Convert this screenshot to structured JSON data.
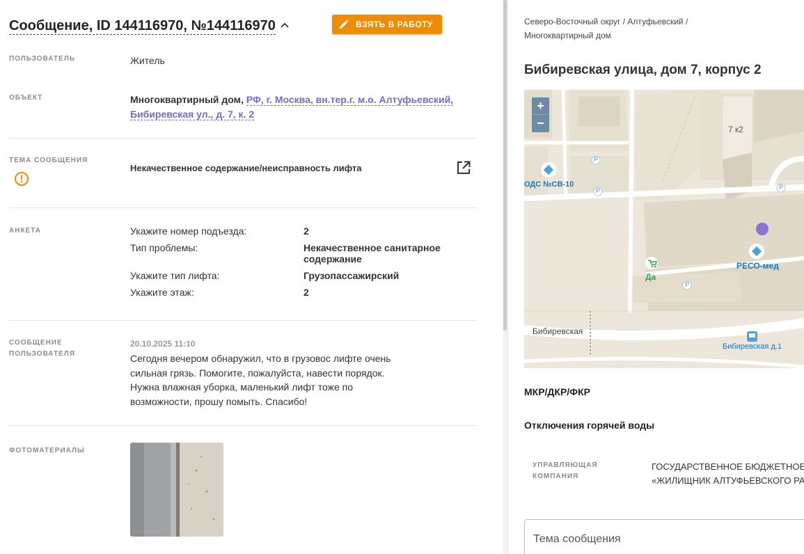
{
  "message": {
    "title": "Сообщение, ID 144116970, №144116970",
    "take_button_label": "ВЗЯТЬ В РАБОТУ",
    "user_label": "ПОЛЬЗОВАТЕЛЬ",
    "user_value": "Житель",
    "object_label": "ОБЪЕКТ",
    "object_type": "Многоквартирный дом,",
    "object_addr_line1": "РФ, г. Москва, вн.тер.г. м.о. Алтуфьевский,",
    "object_addr_line2": "Бибиревская ул., д. 7, к. 2",
    "topic_label": "ТЕМА СООБЩЕНИЯ",
    "topic_value": "Некачественное содержание/неисправность лифта",
    "form_label": "АНКЕТА",
    "form_items": [
      {
        "q": "Укажите номер подъезда:",
        "a": "2"
      },
      {
        "q": "Тип проблемы:",
        "a": "Некачественное санитарное содержание"
      },
      {
        "q": "Укажите тип лифта:",
        "a": "Грузопассажирский"
      },
      {
        "q": "Укажите этаж:",
        "a": "2"
      }
    ],
    "user_msg_label_1": "СООБЩЕНИЕ",
    "user_msg_label_2": "ПОЛЬЗОВАТЕЛЯ",
    "user_msg_date": "20.10.2025 11:10",
    "user_msg_lines": [
      "Сегодня вечером обнаружил, что в грузовос лифте очень",
      "сильная грязь. Помогите, пожалуйста, навести порядок.",
      "Нужна влажная уборка, маленький лифт тоже по",
      "возможности, прошу помыть. Спасибо!"
    ],
    "photos_label": "ФОТОМАТЕРИАЛЫ"
  },
  "side": {
    "breadcrumb_line1": "Северо-Восточный округ / Алтуфьевский /",
    "breadcrumb_line2": "Многоквартирный дом",
    "address": "Бибиревская улица, дом 7, корпус 2",
    "map": {
      "zoom_in": "+",
      "zoom_out": "−",
      "building_label": "7 к2",
      "ods_label": "ОДС №СВ-10",
      "reso_label": "РЕСО-мед",
      "da_label": "Да",
      "street_label": "Бибиревская",
      "bus_stop_label": "Бибиревская д.1",
      "parking": "P",
      "marker_color": "#8c72d6"
    },
    "mkr_label": "МКР/ДКР/ФКР",
    "hot_water_label": "Отключения горячей воды",
    "mc_label_1": "УПРАВЛЯЮЩАЯ",
    "mc_label_2": "КОМПАНИЯ",
    "mc_value_1": "ГОСУДАРСТВЕННОЕ БЮДЖЕТНОЕ",
    "mc_value_2": "«ЖИЛИЩНИК АЛТУФЬЕВСКОГО РАЙОНА»",
    "topic_input_label": "Тема сообщения"
  },
  "colors": {
    "accent_orange": "#f08c00",
    "link_purple": "#7b68c8",
    "map_blue": "#1677c9"
  }
}
